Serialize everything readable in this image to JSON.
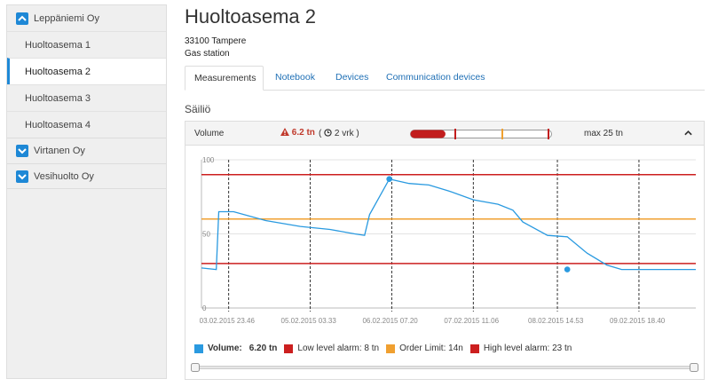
{
  "sidebar": {
    "groups": [
      {
        "label": "Leppäniemi Oy",
        "expanded": true
      },
      {
        "label": "Virtanen Oy",
        "expanded": false
      },
      {
        "label": "Vesihuolto Oy",
        "expanded": false
      }
    ],
    "items": [
      "Huoltoasema 1",
      "Huoltoasema 2",
      "Huoltoasema 3",
      "Huoltoasema 4"
    ],
    "active_item": "Huoltoasema 2"
  },
  "page": {
    "title": "Huoltoasema 2",
    "address_line": "33100 Tampere",
    "type_line": "Gas station"
  },
  "tabs": [
    "Measurements",
    "Notebook",
    "Devices",
    "Communication devices"
  ],
  "active_tab": "Measurements",
  "section_title": "Säiliö",
  "panel": {
    "label": "Volume",
    "value": "6.2 tn",
    "age_open": "(",
    "age": "2 vrk )",
    "max": "max 25 tn",
    "gauge_fill_fraction": 0.248
  },
  "colors": {
    "accent": "#1e88d6",
    "alarm": "#cc1f1f",
    "order": "#f0a030",
    "series": "#2a9ae0"
  },
  "legend": {
    "volume_label": "Volume:",
    "volume_value": "6.20 tn",
    "low": "Low level alarm: 8 tn",
    "order": "Order Limit: 14n",
    "high": "High level alarm: 23 tn"
  },
  "chart_data": {
    "type": "line",
    "ylim": [
      0,
      100
    ],
    "yticks": [
      "100",
      "50",
      "0"
    ],
    "xticks": [
      "03.02.2015 23.46",
      "05.02.2015 03.33",
      "06.02.2015 07.20",
      "07.02.2015 11.06",
      "08.02.2015 14.53",
      "09.02.2015 18.40"
    ],
    "thresholds": [
      {
        "name": "High level alarm",
        "value": 90,
        "color": "#cc1f1f"
      },
      {
        "name": "Order Limit",
        "value": 60,
        "color": "#f0a030"
      },
      {
        "name": "Low level alarm",
        "value": 30,
        "color": "#cc1f1f"
      }
    ],
    "series": [
      {
        "name": "Volume",
        "x": [
          0,
          0.03,
          0.035,
          0.065,
          0.13,
          0.2,
          0.26,
          0.31,
          0.33,
          0.34,
          0.38,
          0.42,
          0.46,
          0.5,
          0.55,
          0.6,
          0.63,
          0.65,
          0.7,
          0.74,
          0.78,
          0.82,
          0.85,
          0.88,
          1.0
        ],
        "values": [
          27,
          26,
          65,
          65,
          59,
          55,
          53,
          50,
          49,
          63,
          87,
          84,
          83,
          79,
          73,
          70,
          66,
          58,
          49,
          48,
          37,
          29,
          26,
          26,
          26
        ]
      }
    ]
  }
}
